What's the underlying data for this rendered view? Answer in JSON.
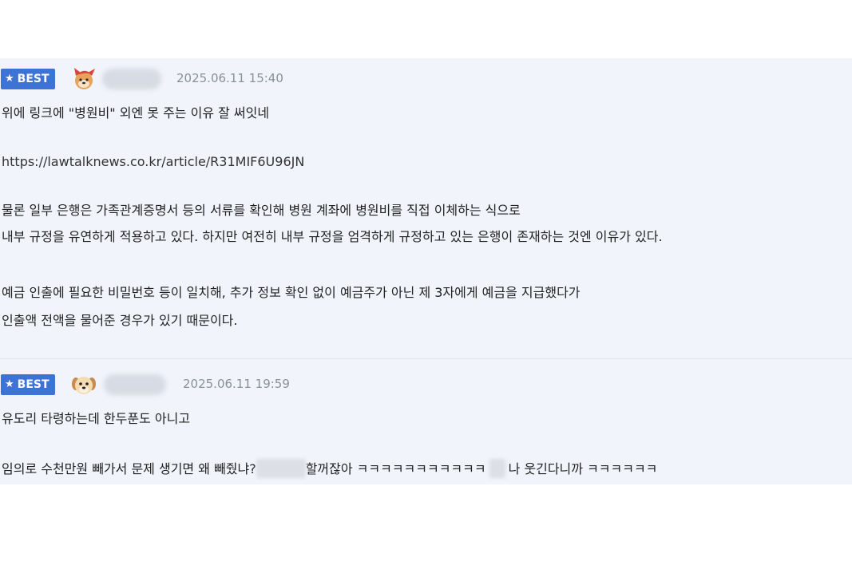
{
  "comments": [
    {
      "badge": "BEST",
      "avatar_icon": "fox-avatar-icon",
      "date": "2025.06.11 15:40",
      "lines": {
        "l1": "위에 링크에 \"병원비\" 외엔 못 주는 이유 잘 써잇네",
        "l2": "https://lawtalknews.co.kr/article/R31MIF6U96JN",
        "l3": "물론 일부 은행은 가족관계증명서 등의 서류를 확인해 병원 계좌에 병원비를 직접 이체하는 식으로",
        "l4": "내부 규정을 유연하게 적용하고 있다. 하지만 여전히 내부 규정을 엄격하게 규정하고 있는 은행이 존재하는 것엔 이유가 있다.",
        "l5": "예금 인출에 필요한 비밀번호 등이 일치해, 추가 정보 확인 없이 예금주가 아닌 제 3자에게 예금을 지급했다가",
        "l6": "인출액 전액을 물어준 경우가 있기 때문이다."
      }
    },
    {
      "badge": "BEST",
      "avatar_icon": "puppy-avatar-icon",
      "date": "2025.06.11 19:59",
      "lines": {
        "l1": "유도리 타령하는데 한두푼도 아니고",
        "l2a": "임의로 수천만원 빼가서 문제 생기면 왜 빼줬냐?",
        "l2b": "할꺼잖아 ㅋㅋㅋㅋㅋㅋㅋㅋㅋㅋㅋ",
        "l2c": "나 웃긴다니까 ㅋㅋㅋㅋㅋㅋ"
      }
    }
  ],
  "colors": {
    "panel_bg": "#f1f4fa",
    "badge_bg": "#3e73d6",
    "date": "#8a8f99",
    "text": "#222222"
  }
}
